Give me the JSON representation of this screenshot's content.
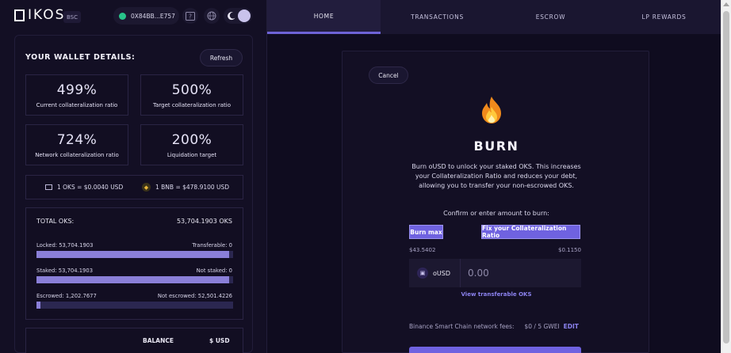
{
  "header": {
    "logo": "IKOS",
    "network": "BSC",
    "wallet_address": "0X84BB...E757"
  },
  "nav": {
    "tabs": [
      {
        "label": "HOME",
        "active": true
      },
      {
        "label": "TRANSACTIONS",
        "active": false
      },
      {
        "label": "ESCROW",
        "active": false
      },
      {
        "label": "LP REWARDS",
        "active": false
      }
    ]
  },
  "wallet": {
    "title": "YOUR WALLET DETAILS:",
    "refresh_label": "Refresh",
    "stats": [
      {
        "value": "499%",
        "label": "Current collateralization ratio"
      },
      {
        "value": "500%",
        "label": "Target collateralization ratio"
      },
      {
        "value": "724%",
        "label": "Network collateralization ratio"
      },
      {
        "value": "200%",
        "label": "Liquidation target"
      }
    ],
    "oks_price": "1 OKS = $0.0040 USD",
    "bnb_price": "1 BNB = $478.9100 USD",
    "total_label": "TOTAL OKS:",
    "total_value": "53,704.1903 OKS",
    "rows": [
      {
        "left": "Locked: 53,704.1903",
        "right": "Transferable: 0",
        "fill": 0.98
      },
      {
        "left": "Staked: 53,704.1903",
        "right": "Not staked: 0",
        "fill": 0.98
      },
      {
        "left": "Escrowed: 1,202.7677",
        "right": "Not escrowed: 52,501.4226",
        "fill": 0.02
      }
    ],
    "balance_header": "BALANCE",
    "usd_header": "$ USD"
  },
  "burn": {
    "cancel_label": "Cancel",
    "icon": "fire-icon",
    "title": "BURN",
    "description": "Burn oUSD to unlock your staked OKS. This increases your Collateralization Ratio and reduces your debt, allowing you to transfer your non-escrowed OKS.",
    "confirm_text": "Confirm or enter amount to burn:",
    "burn_max_label": "Burn max",
    "fix_ratio_label": "Fix your Collateralization Ratio",
    "burn_max_value": "$43.5402",
    "fix_ratio_value": "$0.1150",
    "currency": "oUSD",
    "amount_placeholder": "0.00",
    "view_link": "View transferable OKS",
    "fees_label": "Binance Smart Chain network fees:",
    "fees_value": "$0 / 5 GWEI",
    "edit_label": "EDIT"
  },
  "colors": {
    "accent": "#6f62e0",
    "bar_fill": "#8a7fd8",
    "bar_track": "#2b2750",
    "background": "#0f0c1f",
    "link": "#8b82ef",
    "online": "#28c48a"
  }
}
